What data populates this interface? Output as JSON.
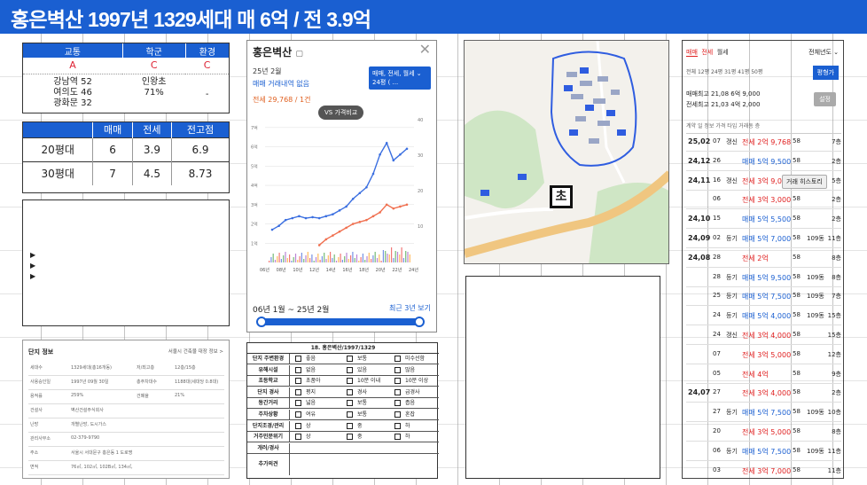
{
  "banner": {
    "title": "홍은벽산 1997년 1329세대 매 6억 / 전 3.9억"
  },
  "location": {
    "headers": [
      "교통",
      "학군",
      "환경"
    ],
    "grades": [
      "A",
      "C",
      "C"
    ],
    "transport": [
      "강남역 52",
      "여의도 46",
      "광화문 32"
    ],
    "school": [
      "인왕초",
      "71%"
    ],
    "environment": "-"
  },
  "price_table": {
    "headers": [
      "",
      "매매",
      "전세",
      "전고점"
    ],
    "rows": [
      {
        "size": "20평대",
        "sale": "6",
        "jeonse": "3.9",
        "peak": "6.9"
      },
      {
        "size": "30평대",
        "sale": "7",
        "jeonse": "4.5",
        "peak": "8.73"
      }
    ]
  },
  "chart_panel": {
    "title": "홍은벽산",
    "date": "25년 2월",
    "sale_line": "매매 거래내역 없음",
    "jeonse_line": "전세 29,768 / 1건",
    "compare_pill": "VS 가격비교",
    "dropdown_l1": "매매, 전세, 월세",
    "dropdown_l2": "24평 (  ...",
    "range_label": "06년 1월 ~ 25년 2월",
    "recent_label": "최근 3년 보기"
  },
  "chart_data": {
    "type": "line",
    "x_ticks": [
      "06년",
      "08년",
      "10년",
      "12년",
      "14년",
      "16년",
      "18년",
      "20년",
      "22년",
      "24년"
    ],
    "y_left_ticks": [
      "7억",
      "6억",
      "5억",
      "4억",
      "3억",
      "2억",
      "1억"
    ],
    "y_right_ticks": [
      "40",
      "30",
      "20",
      "10"
    ],
    "series": [
      {
        "color": "#3b6fe0",
        "values": [
          1.7,
          1.9,
          2.2,
          2.3,
          2.4,
          2.3,
          2.35,
          2.3,
          2.4,
          2.5,
          2.7,
          2.9,
          3.3,
          3.6,
          3.9,
          4.6,
          5.6,
          6.2,
          5.3,
          5.6,
          5.9
        ]
      },
      {
        "color": "#f07050",
        "values": [
          null,
          null,
          null,
          null,
          null,
          null,
          null,
          0.9,
          1.2,
          1.4,
          1.6,
          1.8,
          2.0,
          2.1,
          2.2,
          2.4,
          2.6,
          3.0,
          2.8,
          2.9,
          3.0
        ]
      }
    ]
  },
  "complex_info": {
    "title": "단지 정보",
    "link": "서울시 건축물 대장 정보 >",
    "rows": [
      {
        "k1": "세대수",
        "v1": "1329세대(총16개동)",
        "k2": "저/최고층",
        "v2": "12층/15층"
      },
      {
        "k1": "사용승인일",
        "v1": "1997년 09월 30일",
        "k2": "총주차대수",
        "v2": "1188대(세대당 0.8대)"
      },
      {
        "k1": "용적률",
        "v1": "259%",
        "k2": "건폐율",
        "v2": "21%"
      },
      {
        "k1": "건설사",
        "v1": "벽산건설주식회사",
        "k2": "",
        "v2": ""
      },
      {
        "k1": "난방",
        "v1": "개별난방, 도시가스",
        "k2": "",
        "v2": ""
      },
      {
        "k1": "관리사무소",
        "v1": "02-379-9790",
        "k2": "",
        "v2": ""
      },
      {
        "k1": "주소",
        "v1": "서울시 서대문구 홍은동 1 도로명: 서울시 서대문구 세검정로 1길 95",
        "k2": "",
        "v2": ""
      },
      {
        "k1": "면적",
        "v1": "76㎡, 102㎡, 102B㎡, 134㎡, 164㎡",
        "k2": "",
        "v2": ""
      }
    ]
  },
  "checklist": {
    "title": "18. 홍은벽산/1997/1329",
    "rows": [
      {
        "label": "단지 주변환경",
        "opts": [
          "좋음",
          "보통",
          "미수선함"
        ]
      },
      {
        "label": "유해시설",
        "opts": [
          "없음",
          "있음",
          "많음"
        ]
      },
      {
        "label": "초등학교",
        "opts": [
          "초품아",
          "10분 이내",
          "10분 이상"
        ]
      },
      {
        "label": "단지 경사",
        "opts": [
          "평지",
          "경사",
          "급경사"
        ]
      },
      {
        "label": "동간거리",
        "opts": [
          "넓음",
          "보통",
          "좁음"
        ]
      },
      {
        "label": "주차상황",
        "opts": [
          "여유",
          "보통",
          "혼잡"
        ]
      },
      {
        "label": "단지조경/관리",
        "opts": [
          "상",
          "중",
          "하"
        ]
      },
      {
        "label": "거주민분위기",
        "opts": [
          "상",
          "중",
          "하"
        ]
      },
      {
        "label": "개러/경사",
        "opts": [
          "",
          "",
          ""
        ]
      },
      {
        "label": "추가의견",
        "opts": [
          "",
          "",
          ""
        ]
      }
    ]
  },
  "transactions": {
    "tabs": [
      "매매",
      "전세",
      "월세"
    ],
    "year_select": "전체년도",
    "summary_l1": "전체  12평  24평  31평  41평  50평",
    "compare_btn": "평형가",
    "high1": "매매최고 21,08 6억 9,000",
    "high2": "전세최고 21,03 4억 2,000",
    "set_btn": "설정",
    "cols": "계약  일  정보  가격  타입  거래동  층",
    "tooltip": "거래 히스토리",
    "rows": [
      {
        "ym": "25,02",
        "d": "07",
        "info": "갱신",
        "price": "전세 2억 9,768",
        "t": "58",
        "dong": "",
        "fl": "7층",
        "kind": "j"
      },
      {
        "ym": "24,12",
        "d": "26",
        "info": "",
        "price": "매매 5억 9,500",
        "t": "58",
        "dong": "",
        "fl": "2층",
        "kind": "s"
      },
      {
        "ym": "24,11",
        "d": "16",
        "info": "갱신",
        "price": "전세 3억 9,000",
        "t": "58",
        "dong": "",
        "fl": "5층",
        "kind": "j"
      },
      {
        "ym": "",
        "d": "06",
        "info": "",
        "price": "전세 3억 3,000",
        "t": "58",
        "dong": "",
        "fl": "2층",
        "kind": "j"
      },
      {
        "ym": "24,10",
        "d": "15",
        "info": "",
        "price": "매매 5억 5,500",
        "t": "58",
        "dong": "",
        "fl": "2층",
        "kind": "s"
      },
      {
        "ym": "24,09",
        "d": "02",
        "info": "등기",
        "price": "매매 5억 7,000",
        "t": "58",
        "dong": "109동",
        "fl": "11층",
        "kind": "s"
      },
      {
        "ym": "24,08",
        "d": "28",
        "info": "",
        "price": "전세 2억",
        "t": "58",
        "dong": "",
        "fl": "8층",
        "kind": "j"
      },
      {
        "ym": "",
        "d": "28",
        "info": "등기",
        "price": "매매 5억 9,500",
        "t": "58",
        "dong": "109동",
        "fl": "8층",
        "kind": "s"
      },
      {
        "ym": "",
        "d": "25",
        "info": "등기",
        "price": "매매 5억 7,500",
        "t": "58",
        "dong": "109동",
        "fl": "7층",
        "kind": "s"
      },
      {
        "ym": "",
        "d": "24",
        "info": "등기",
        "price": "매매 5억 4,000",
        "t": "58",
        "dong": "109동",
        "fl": "15층",
        "kind": "s"
      },
      {
        "ym": "",
        "d": "24",
        "info": "갱신",
        "price": "전세 3억 4,000",
        "t": "58",
        "dong": "",
        "fl": "15층",
        "kind": "j"
      },
      {
        "ym": "",
        "d": "07",
        "info": "",
        "price": "전세 3억 5,000",
        "t": "58",
        "dong": "",
        "fl": "12층",
        "kind": "j"
      },
      {
        "ym": "",
        "d": "05",
        "info": "",
        "price": "전세 4억",
        "t": "58",
        "dong": "",
        "fl": "9층",
        "kind": "j"
      },
      {
        "ym": "24,07",
        "d": "27",
        "info": "",
        "price": "전세 3억 4,000",
        "t": "58",
        "dong": "",
        "fl": "2층",
        "kind": "j"
      },
      {
        "ym": "",
        "d": "27",
        "info": "등기",
        "price": "매매 5억 7,500",
        "t": "58",
        "dong": "109동",
        "fl": "10층",
        "kind": "s"
      },
      {
        "ym": "",
        "d": "20",
        "info": "",
        "price": "전세 3억 5,000",
        "t": "58",
        "dong": "",
        "fl": "8층",
        "kind": "j"
      },
      {
        "ym": "",
        "d": "06",
        "info": "등기",
        "price": "매매 5억 7,500",
        "t": "58",
        "dong": "109동",
        "fl": "11층",
        "kind": "s"
      },
      {
        "ym": "",
        "d": "03",
        "info": "",
        "price": "전세 3억 7,000",
        "t": "58",
        "dong": "",
        "fl": "11층",
        "kind": "j"
      }
    ]
  },
  "map": {
    "school_marker": "초"
  },
  "notes": {
    "arrows": [
      "▶",
      "▶",
      "▶"
    ]
  }
}
